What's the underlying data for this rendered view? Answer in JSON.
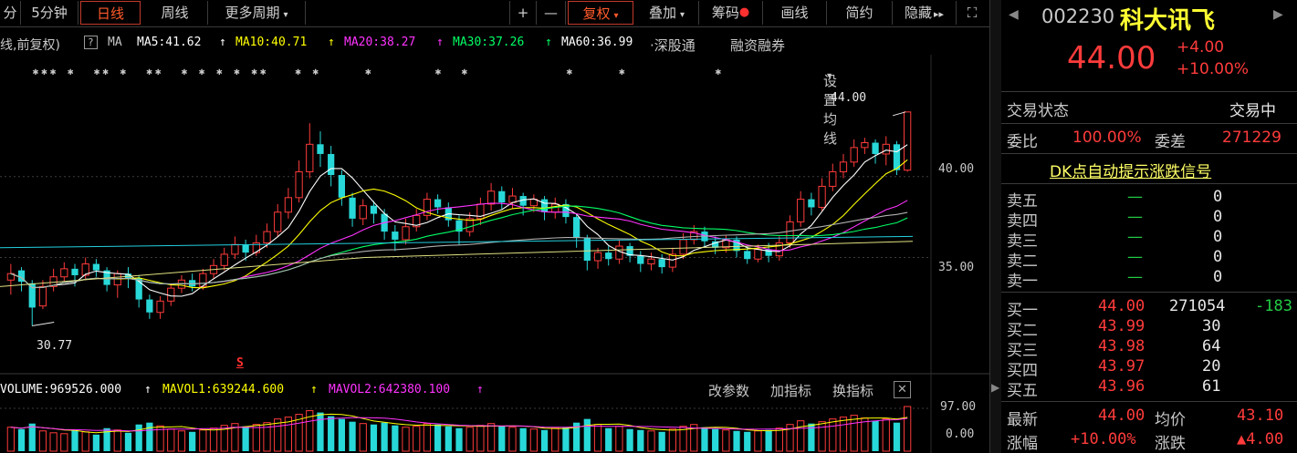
{
  "toolbar": {
    "items": [
      {
        "label": "分"
      },
      {
        "label": "5分钟"
      },
      {
        "label": "日线"
      },
      {
        "label": "周线"
      },
      {
        "label": "更多周期"
      },
      {
        "label": "+"
      },
      {
        "label": "—"
      },
      {
        "label": "复权"
      },
      {
        "label": "叠加"
      },
      {
        "label": "筹码"
      },
      {
        "label": "画线"
      },
      {
        "label": "简约"
      },
      {
        "label": "隐藏"
      },
      {
        "label": "⛶"
      }
    ],
    "arrow": "▾",
    "double_arrow": "▸▸"
  },
  "legend": {
    "prefix": "线,前复权)",
    "help": "?",
    "ma": "MA",
    "ma5": "MA5:41.62",
    "ma10": "MA10:40.71",
    "ma20": "MA20:38.27",
    "ma30": "MA30:37.26",
    "ma60": "MA60:36.99",
    "up_arrow": "↑",
    "colors": {
      "ma5": "#ffffff",
      "ma10": "#ffff00",
      "ma20": "#ff33ff",
      "ma30": "#00ff66",
      "ma60": "#ffffff"
    }
  },
  "links": {
    "hk_connect": "·深股通",
    "margin": "融资融券",
    "settings": "设置均线"
  },
  "chart_data": {
    "type": "candlestick",
    "y_ticks": [
      "40.00",
      "35.00"
    ],
    "high_label": "44.00",
    "low_label": "30.77",
    "signal_label": "S",
    "volume_ticks": [
      "97.00",
      "0.00"
    ],
    "price_range": [
      29.5,
      45.4
    ],
    "series_ma": [
      "MA5",
      "MA10",
      "MA20",
      "MA30",
      "MA60"
    ],
    "candles": [
      {
        "x": 1,
        "o": 33.6,
        "c": 34.0,
        "h": 34.6,
        "l": 32.7
      },
      {
        "x": 2,
        "o": 34.2,
        "c": 33.5,
        "h": 34.4,
        "l": 32.9
      },
      {
        "x": 3,
        "o": 33.4,
        "c": 31.9,
        "h": 33.6,
        "l": 30.77
      },
      {
        "x": 4,
        "o": 32.0,
        "c": 33.2,
        "h": 33.6,
        "l": 31.8
      },
      {
        "x": 5,
        "o": 33.2,
        "c": 33.8,
        "h": 34.3,
        "l": 32.9
      },
      {
        "x": 6,
        "o": 33.8,
        "c": 34.3,
        "h": 34.7,
        "l": 33.5
      },
      {
        "x": 7,
        "o": 34.3,
        "c": 33.9,
        "h": 34.6,
        "l": 33.2
      },
      {
        "x": 8,
        "o": 33.9,
        "c": 34.6,
        "h": 35.0,
        "l": 33.6
      },
      {
        "x": 9,
        "o": 34.6,
        "c": 34.2,
        "h": 34.9,
        "l": 33.8
      },
      {
        "x": 10,
        "o": 34.2,
        "c": 33.3,
        "h": 34.4,
        "l": 32.9
      },
      {
        "x": 11,
        "o": 33.3,
        "c": 34.0,
        "h": 34.2,
        "l": 32.5
      },
      {
        "x": 12,
        "o": 34.0,
        "c": 33.7,
        "h": 34.4,
        "l": 33.1
      },
      {
        "x": 13,
        "o": 33.7,
        "c": 32.4,
        "h": 33.9,
        "l": 31.9
      },
      {
        "x": 14,
        "o": 32.4,
        "c": 31.6,
        "h": 32.7,
        "l": 31.2
      },
      {
        "x": 15,
        "o": 31.6,
        "c": 32.3,
        "h": 32.6,
        "l": 31.2
      },
      {
        "x": 16,
        "o": 32.3,
        "c": 33.1,
        "h": 33.4,
        "l": 32.0
      },
      {
        "x": 17,
        "o": 33.1,
        "c": 33.6,
        "h": 33.9,
        "l": 32.8
      },
      {
        "x": 18,
        "o": 33.6,
        "c": 33.2,
        "h": 34.0,
        "l": 32.9
      },
      {
        "x": 19,
        "o": 33.2,
        "c": 34.0,
        "h": 34.3,
        "l": 33.0
      },
      {
        "x": 20,
        "o": 34.0,
        "c": 34.5,
        "h": 34.9,
        "l": 33.7
      },
      {
        "x": 21,
        "o": 34.5,
        "c": 35.2,
        "h": 35.6,
        "l": 34.2
      },
      {
        "x": 22,
        "o": 35.2,
        "c": 35.8,
        "h": 36.3,
        "l": 34.9
      },
      {
        "x": 23,
        "o": 35.8,
        "c": 35.3,
        "h": 36.1,
        "l": 34.8
      },
      {
        "x": 24,
        "o": 35.3,
        "c": 35.9,
        "h": 36.4,
        "l": 35.1
      },
      {
        "x": 25,
        "o": 35.9,
        "c": 36.6,
        "h": 37.1,
        "l": 35.6
      },
      {
        "x": 26,
        "o": 36.6,
        "c": 37.8,
        "h": 38.3,
        "l": 36.3
      },
      {
        "x": 27,
        "o": 37.8,
        "c": 38.7,
        "h": 39.3,
        "l": 37.4
      },
      {
        "x": 28,
        "o": 38.7,
        "c": 40.3,
        "h": 41.0,
        "l": 38.4
      },
      {
        "x": 29,
        "o": 40.3,
        "c": 42.0,
        "h": 43.3,
        "l": 39.9
      },
      {
        "x": 30,
        "o": 42.0,
        "c": 41.4,
        "h": 42.8,
        "l": 40.6
      },
      {
        "x": 31,
        "o": 41.4,
        "c": 40.1,
        "h": 41.9,
        "l": 39.4
      },
      {
        "x": 32,
        "o": 40.1,
        "c": 38.7,
        "h": 40.4,
        "l": 38.2
      },
      {
        "x": 33,
        "o": 38.7,
        "c": 37.4,
        "h": 39.0,
        "l": 36.9
      },
      {
        "x": 34,
        "o": 37.4,
        "c": 38.2,
        "h": 38.6,
        "l": 37.0
      },
      {
        "x": 35,
        "o": 38.2,
        "c": 37.7,
        "h": 38.5,
        "l": 37.1
      },
      {
        "x": 36,
        "o": 37.7,
        "c": 36.6,
        "h": 38.0,
        "l": 36.1
      },
      {
        "x": 37,
        "o": 36.6,
        "c": 36.1,
        "h": 37.0,
        "l": 35.4
      },
      {
        "x": 38,
        "o": 36.1,
        "c": 36.9,
        "h": 37.4,
        "l": 35.8
      },
      {
        "x": 39,
        "o": 36.9,
        "c": 37.6,
        "h": 38.0,
        "l": 36.6
      },
      {
        "x": 40,
        "o": 37.6,
        "c": 38.6,
        "h": 39.0,
        "l": 37.3
      },
      {
        "x": 41,
        "o": 38.6,
        "c": 38.1,
        "h": 38.9,
        "l": 37.7
      },
      {
        "x": 42,
        "o": 38.1,
        "c": 37.3,
        "h": 38.4,
        "l": 36.9
      },
      {
        "x": 43,
        "o": 37.3,
        "c": 36.6,
        "h": 37.6,
        "l": 35.8
      },
      {
        "x": 44,
        "o": 36.6,
        "c": 37.4,
        "h": 37.8,
        "l": 36.3
      },
      {
        "x": 45,
        "o": 37.4,
        "c": 38.3,
        "h": 38.7,
        "l": 37.0
      },
      {
        "x": 46,
        "o": 38.3,
        "c": 39.1,
        "h": 39.6,
        "l": 37.9
      },
      {
        "x": 47,
        "o": 39.1,
        "c": 38.4,
        "h": 39.4,
        "l": 38.0
      },
      {
        "x": 48,
        "o": 38.4,
        "c": 38.8,
        "h": 39.3,
        "l": 38.0
      },
      {
        "x": 49,
        "o": 38.8,
        "c": 38.2,
        "h": 39.0,
        "l": 37.6
      },
      {
        "x": 50,
        "o": 38.2,
        "c": 38.6,
        "h": 38.9,
        "l": 37.8
      },
      {
        "x": 51,
        "o": 38.6,
        "c": 37.8,
        "h": 38.8,
        "l": 37.3
      },
      {
        "x": 52,
        "o": 37.8,
        "c": 38.3,
        "h": 38.7,
        "l": 37.4
      },
      {
        "x": 53,
        "o": 38.3,
        "c": 37.5,
        "h": 38.6,
        "l": 37.1
      },
      {
        "x": 54,
        "o": 37.5,
        "c": 36.2,
        "h": 37.7,
        "l": 35.6
      },
      {
        "x": 55,
        "o": 36.2,
        "c": 34.8,
        "h": 36.4,
        "l": 34.2
      },
      {
        "x": 56,
        "o": 34.8,
        "c": 35.3,
        "h": 35.6,
        "l": 34.3
      },
      {
        "x": 57,
        "o": 35.3,
        "c": 34.9,
        "h": 35.7,
        "l": 34.5
      },
      {
        "x": 58,
        "o": 34.9,
        "c": 35.7,
        "h": 36.1,
        "l": 34.6
      },
      {
        "x": 59,
        "o": 35.7,
        "c": 35.1,
        "h": 35.9,
        "l": 34.7
      },
      {
        "x": 60,
        "o": 35.1,
        "c": 34.6,
        "h": 35.4,
        "l": 34.1
      },
      {
        "x": 61,
        "o": 34.6,
        "c": 34.9,
        "h": 35.3,
        "l": 34.2
      },
      {
        "x": 62,
        "o": 34.9,
        "c": 34.4,
        "h": 35.2,
        "l": 34.0
      },
      {
        "x": 63,
        "o": 34.4,
        "c": 35.2,
        "h": 35.6,
        "l": 34.1
      },
      {
        "x": 64,
        "o": 35.2,
        "c": 36.1,
        "h": 36.5,
        "l": 34.9
      },
      {
        "x": 65,
        "o": 36.1,
        "c": 36.6,
        "h": 37.0,
        "l": 35.8
      },
      {
        "x": 66,
        "o": 36.6,
        "c": 36.0,
        "h": 36.9,
        "l": 35.6
      },
      {
        "x": 67,
        "o": 36.0,
        "c": 35.6,
        "h": 36.3,
        "l": 35.2
      },
      {
        "x": 68,
        "o": 35.6,
        "c": 36.1,
        "h": 36.4,
        "l": 35.3
      },
      {
        "x": 69,
        "o": 36.1,
        "c": 35.4,
        "h": 36.3,
        "l": 35.0
      },
      {
        "x": 70,
        "o": 35.4,
        "c": 34.9,
        "h": 35.7,
        "l": 34.6
      },
      {
        "x": 71,
        "o": 34.9,
        "c": 35.5,
        "h": 35.8,
        "l": 34.7
      },
      {
        "x": 72,
        "o": 35.5,
        "c": 35.1,
        "h": 35.9,
        "l": 34.7
      },
      {
        "x": 73,
        "o": 35.1,
        "c": 35.9,
        "h": 36.3,
        "l": 34.8
      },
      {
        "x": 74,
        "o": 35.9,
        "c": 37.2,
        "h": 37.6,
        "l": 35.6
      },
      {
        "x": 75,
        "o": 37.2,
        "c": 38.6,
        "h": 39.1,
        "l": 36.9
      },
      {
        "x": 76,
        "o": 38.6,
        "c": 38.1,
        "h": 39.0,
        "l": 37.6
      },
      {
        "x": 77,
        "o": 38.1,
        "c": 39.4,
        "h": 39.9,
        "l": 37.9
      },
      {
        "x": 78,
        "o": 39.4,
        "c": 40.3,
        "h": 40.8,
        "l": 39.1
      },
      {
        "x": 79,
        "o": 40.3,
        "c": 40.9,
        "h": 41.4,
        "l": 39.9
      },
      {
        "x": 80,
        "o": 40.9,
        "c": 41.8,
        "h": 42.3,
        "l": 40.6
      },
      {
        "x": 81,
        "o": 41.8,
        "c": 42.1,
        "h": 42.4,
        "l": 41.4
      },
      {
        "x": 82,
        "o": 42.1,
        "c": 41.4,
        "h": 42.3,
        "l": 40.8
      },
      {
        "x": 83,
        "o": 41.4,
        "c": 42.0,
        "h": 42.5,
        "l": 40.7
      },
      {
        "x": 84,
        "o": 42.0,
        "c": 40.4,
        "h": 42.2,
        "l": 40.1
      },
      {
        "x": 85,
        "o": 40.4,
        "c": 44.0,
        "h": 44.0,
        "l": 40.3
      }
    ],
    "volume": [
      52,
      48,
      60,
      44,
      40,
      38,
      45,
      42,
      36,
      50,
      46,
      40,
      58,
      62,
      55,
      48,
      44,
      42,
      46,
      50,
      56,
      60,
      54,
      58,
      62,
      70,
      74,
      80,
      88,
      84,
      76,
      70,
      64,
      60,
      58,
      62,
      56,
      52,
      54,
      60,
      58,
      54,
      50,
      52,
      56,
      60,
      54,
      52,
      50,
      48,
      46,
      50,
      52,
      62,
      70,
      58,
      50,
      54,
      48,
      46,
      44,
      42,
      48,
      54,
      58,
      52,
      48,
      46,
      44,
      42,
      44,
      46,
      50,
      58,
      66,
      60,
      64,
      70,
      74,
      78,
      72,
      66,
      70,
      62,
      97
    ],
    "volume_colors_up_down": "up=red, down=cyan"
  },
  "volume_legend": {
    "volume": "VOLUME:969526.000",
    "mavol1": "MAVOL1:639244.600",
    "mavol2": "MAVOL2:642380.100",
    "up_arrow": "↑"
  },
  "volume_buttons": {
    "params": "改参数",
    "add": "加指标",
    "swap": "换指标",
    "close": "✕"
  },
  "panel": {
    "prev_icon": "◀",
    "next_icon": "▶",
    "code": "002230",
    "name": "科大讯飞",
    "price": "44.00",
    "change": "+4.00",
    "change_pct": "+10.00%",
    "status_label": "交易状态",
    "status_value": "交易中",
    "wb_label": "委比",
    "wb_value": "100.00%",
    "wc_label": "委差",
    "wc_value": "271229",
    "signal_link": "DK点自动提示涨跌信号",
    "asks": [
      {
        "label": "卖五",
        "price": "—",
        "vol": "0"
      },
      {
        "label": "卖四",
        "price": "—",
        "vol": "0"
      },
      {
        "label": "卖三",
        "price": "—",
        "vol": "0"
      },
      {
        "label": "卖二",
        "price": "—",
        "vol": "0"
      },
      {
        "label": "卖一",
        "price": "—",
        "vol": "0"
      }
    ],
    "bids": [
      {
        "label": "买一",
        "price": "44.00",
        "vol": "271054",
        "delta": "-183"
      },
      {
        "label": "买二",
        "price": "43.99",
        "vol": "30",
        "delta": ""
      },
      {
        "label": "买三",
        "price": "43.98",
        "vol": "64",
        "delta": ""
      },
      {
        "label": "买四",
        "price": "43.97",
        "vol": "20",
        "delta": ""
      },
      {
        "label": "买五",
        "price": "43.96",
        "vol": "61",
        "delta": ""
      }
    ],
    "latest_label": "最新",
    "latest_value": "44.00",
    "avg_label": "均价",
    "avg_value": "43.10",
    "chg_pct_label": "涨幅",
    "chg_pct_value": "+10.00%",
    "chg_label": "涨跌",
    "chg_value": "▲4.00"
  },
  "divider_grip": "▶"
}
